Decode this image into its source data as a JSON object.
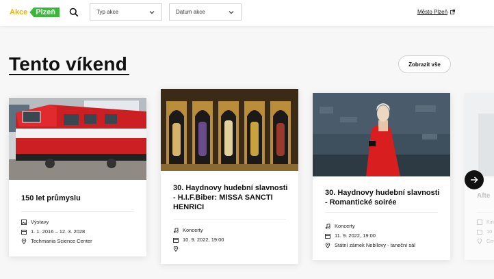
{
  "header": {
    "logo": {
      "part1": "Akce",
      "part2": "Plzeň"
    },
    "filters": {
      "type_label": "Typ akce",
      "date_label": "Datum akce"
    },
    "city_link": "Město Plzeň"
  },
  "section": {
    "title": "Tento víkend",
    "show_all": "Zobrazit vše"
  },
  "cards": [
    {
      "title": "150 let průmyslu",
      "category": "Výstavy",
      "date": "1. 1. 2016 – 12. 3. 2028",
      "place": "Techmania Science Center"
    },
    {
      "title": "30. Haydnovy hudební slavnosti - H.I.F.Biber: MISSA SANCTI HENRICI",
      "category": "Koncerty",
      "date": "10. 9. 2022, 19:00",
      "place": ""
    },
    {
      "title": "30. Haydnovy hudební slavnosti - Romantické soirée",
      "category": "Koncerty",
      "date": "11. 9. 2022, 19:00",
      "place": "Státní zámek Nebílovy - taneční sál"
    },
    {
      "title": "Afte",
      "category": "Kin",
      "date": "10",
      "place": "Cev"
    }
  ],
  "colors": {
    "brand_green": "#3bb73b",
    "brand_yellow": "#e8b400"
  }
}
